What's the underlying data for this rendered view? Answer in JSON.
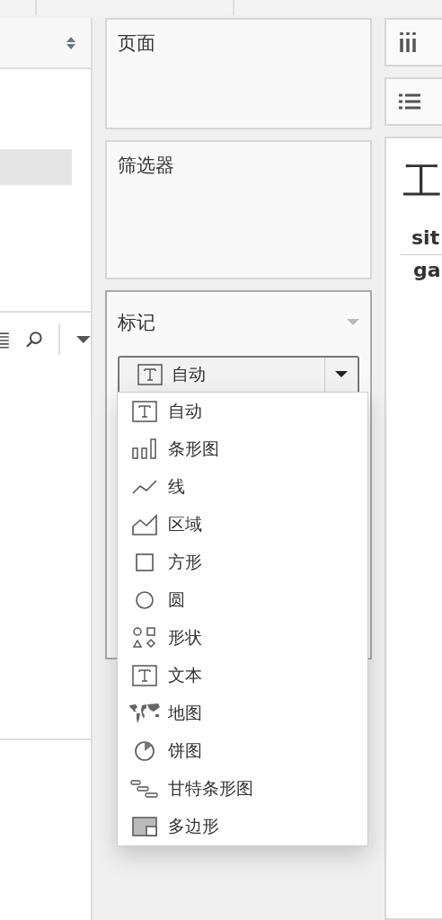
{
  "shelves": [
    {
      "title": "页面"
    },
    {
      "title": "筛选器"
    }
  ],
  "marks": {
    "title": "标记",
    "mark_type": {
      "label": "自动",
      "kind": "text"
    },
    "menu": {
      "open": true,
      "items": [
        {
          "label": "自动",
          "kind": "text"
        },
        {
          "label": "条形图",
          "kind": "bar"
        },
        {
          "label": "线",
          "kind": "line"
        },
        {
          "label": "区域",
          "kind": "area"
        },
        {
          "label": "方形",
          "kind": "square"
        },
        {
          "label": "圆",
          "kind": "circle"
        },
        {
          "label": "形状",
          "kind": "shapes"
        },
        {
          "label": "文本",
          "kind": "text"
        },
        {
          "label": "地图",
          "kind": "map"
        },
        {
          "label": "饼图",
          "kind": "pie"
        },
        {
          "label": "甘特条形图",
          "kind": "gantt"
        },
        {
          "label": "多边形",
          "kind": "polygon"
        }
      ]
    }
  },
  "view": {
    "title": "工",
    "column_header": "sit",
    "row": "ga"
  }
}
